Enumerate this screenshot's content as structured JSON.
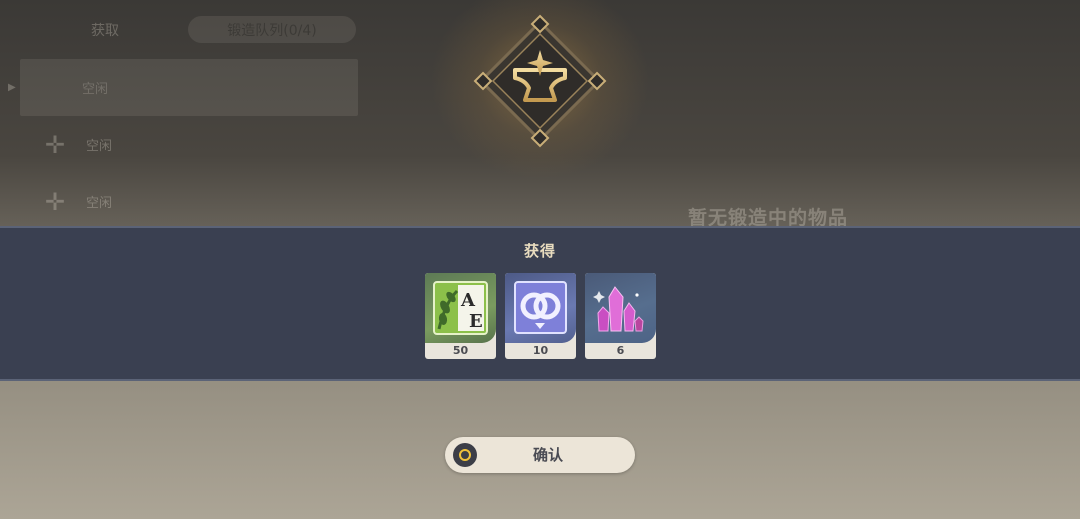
{
  "background": {
    "tab_left": "获取",
    "tab_right": "锻造队列(0/4)",
    "slots": [
      "空闲",
      "空闲",
      "空闲"
    ],
    "heading": "暂无锻造中的物品"
  },
  "emblem": {
    "icon": "anvil-spark-icon",
    "accent": "#e0c27a"
  },
  "banner": {
    "title": "获得",
    "items": [
      {
        "icon": "ae-bundle-icon",
        "count": "50"
      },
      {
        "icon": "interlocked-rings-icon",
        "count": "10"
      },
      {
        "icon": "pink-crystal-icon",
        "count": "6"
      }
    ]
  },
  "confirm": {
    "label": "确认",
    "button_icon": "circle-button-icon"
  },
  "colors": {
    "banner_bg": "#3a4051",
    "title_gold": "#e8dcbf",
    "crystal_pink": "#d85bd0",
    "ring_yellow": "#f0c23a"
  }
}
